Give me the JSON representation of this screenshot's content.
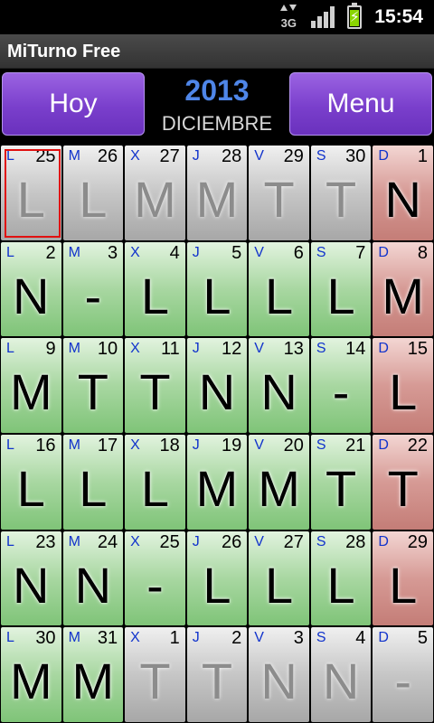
{
  "status_bar": {
    "network_label": "3G",
    "time": "15:54",
    "icons": [
      "network-3g-icon",
      "signal-icon",
      "battery-charging-icon"
    ],
    "battery_level": 0.8
  },
  "app": {
    "title": "MiTurno Free"
  },
  "header": {
    "today_button": "Hoy",
    "menu_button": "Menu",
    "year": "2013",
    "month": "DICIEMBRE"
  },
  "colors": {
    "accent_button": "#7a3fcc",
    "year_text": "#4f86e8",
    "weekday_letter": "#1133cc",
    "green_cell": "#a8d7a1",
    "gray_cell": "#c6c6c6",
    "red_cell": "#d69a95",
    "today_outline": "#e01010"
  },
  "calendar": {
    "weeks": [
      [
        {
          "wd": "L",
          "day": "25",
          "shift": "L",
          "style": "gray",
          "dim": true,
          "today": true
        },
        {
          "wd": "M",
          "day": "26",
          "shift": "L",
          "style": "gray",
          "dim": true
        },
        {
          "wd": "X",
          "day": "27",
          "shift": "M",
          "style": "gray",
          "dim": true
        },
        {
          "wd": "J",
          "day": "28",
          "shift": "M",
          "style": "gray",
          "dim": true
        },
        {
          "wd": "V",
          "day": "29",
          "shift": "T",
          "style": "gray",
          "dim": true
        },
        {
          "wd": "S",
          "day": "30",
          "shift": "T",
          "style": "gray",
          "dim": true
        },
        {
          "wd": "D",
          "day": "1",
          "shift": "N",
          "style": "red",
          "dim": false
        }
      ],
      [
        {
          "wd": "L",
          "day": "2",
          "shift": "N",
          "style": "green",
          "dim": false
        },
        {
          "wd": "M",
          "day": "3",
          "shift": "-",
          "style": "green",
          "dim": false
        },
        {
          "wd": "X",
          "day": "4",
          "shift": "L",
          "style": "green",
          "dim": false
        },
        {
          "wd": "J",
          "day": "5",
          "shift": "L",
          "style": "green",
          "dim": false
        },
        {
          "wd": "V",
          "day": "6",
          "shift": "L",
          "style": "green",
          "dim": false
        },
        {
          "wd": "S",
          "day": "7",
          "shift": "L",
          "style": "green",
          "dim": false
        },
        {
          "wd": "D",
          "day": "8",
          "shift": "M",
          "style": "red",
          "dim": false
        }
      ],
      [
        {
          "wd": "L",
          "day": "9",
          "shift": "M",
          "style": "green",
          "dim": false
        },
        {
          "wd": "M",
          "day": "10",
          "shift": "T",
          "style": "green",
          "dim": false
        },
        {
          "wd": "X",
          "day": "11",
          "shift": "T",
          "style": "green",
          "dim": false
        },
        {
          "wd": "J",
          "day": "12",
          "shift": "N",
          "style": "green",
          "dim": false
        },
        {
          "wd": "V",
          "day": "13",
          "shift": "N",
          "style": "green",
          "dim": false
        },
        {
          "wd": "S",
          "day": "14",
          "shift": "-",
          "style": "green",
          "dim": false
        },
        {
          "wd": "D",
          "day": "15",
          "shift": "L",
          "style": "red",
          "dim": false
        }
      ],
      [
        {
          "wd": "L",
          "day": "16",
          "shift": "L",
          "style": "green",
          "dim": false
        },
        {
          "wd": "M",
          "day": "17",
          "shift": "L",
          "style": "green",
          "dim": false
        },
        {
          "wd": "X",
          "day": "18",
          "shift": "L",
          "style": "green",
          "dim": false
        },
        {
          "wd": "J",
          "day": "19",
          "shift": "M",
          "style": "green",
          "dim": false
        },
        {
          "wd": "V",
          "day": "20",
          "shift": "M",
          "style": "green",
          "dim": false
        },
        {
          "wd": "S",
          "day": "21",
          "shift": "T",
          "style": "green",
          "dim": false
        },
        {
          "wd": "D",
          "day": "22",
          "shift": "T",
          "style": "red",
          "dim": false
        }
      ],
      [
        {
          "wd": "L",
          "day": "23",
          "shift": "N",
          "style": "green",
          "dim": false
        },
        {
          "wd": "M",
          "day": "24",
          "shift": "N",
          "style": "green",
          "dim": false
        },
        {
          "wd": "X",
          "day": "25",
          "shift": "-",
          "style": "green",
          "dim": false
        },
        {
          "wd": "J",
          "day": "26",
          "shift": "L",
          "style": "green",
          "dim": false
        },
        {
          "wd": "V",
          "day": "27",
          "shift": "L",
          "style": "green",
          "dim": false
        },
        {
          "wd": "S",
          "day": "28",
          "shift": "L",
          "style": "green",
          "dim": false
        },
        {
          "wd": "D",
          "day": "29",
          "shift": "L",
          "style": "red",
          "dim": false
        }
      ],
      [
        {
          "wd": "L",
          "day": "30",
          "shift": "M",
          "style": "green",
          "dim": false
        },
        {
          "wd": "M",
          "day": "31",
          "shift": "M",
          "style": "green",
          "dim": false
        },
        {
          "wd": "X",
          "day": "1",
          "shift": "T",
          "style": "gray",
          "dim": true
        },
        {
          "wd": "J",
          "day": "2",
          "shift": "T",
          "style": "gray",
          "dim": true
        },
        {
          "wd": "V",
          "day": "3",
          "shift": "N",
          "style": "gray",
          "dim": true
        },
        {
          "wd": "S",
          "day": "4",
          "shift": "N",
          "style": "gray",
          "dim": true
        },
        {
          "wd": "D",
          "day": "5",
          "shift": "-",
          "style": "gray",
          "dim": true
        }
      ]
    ]
  }
}
